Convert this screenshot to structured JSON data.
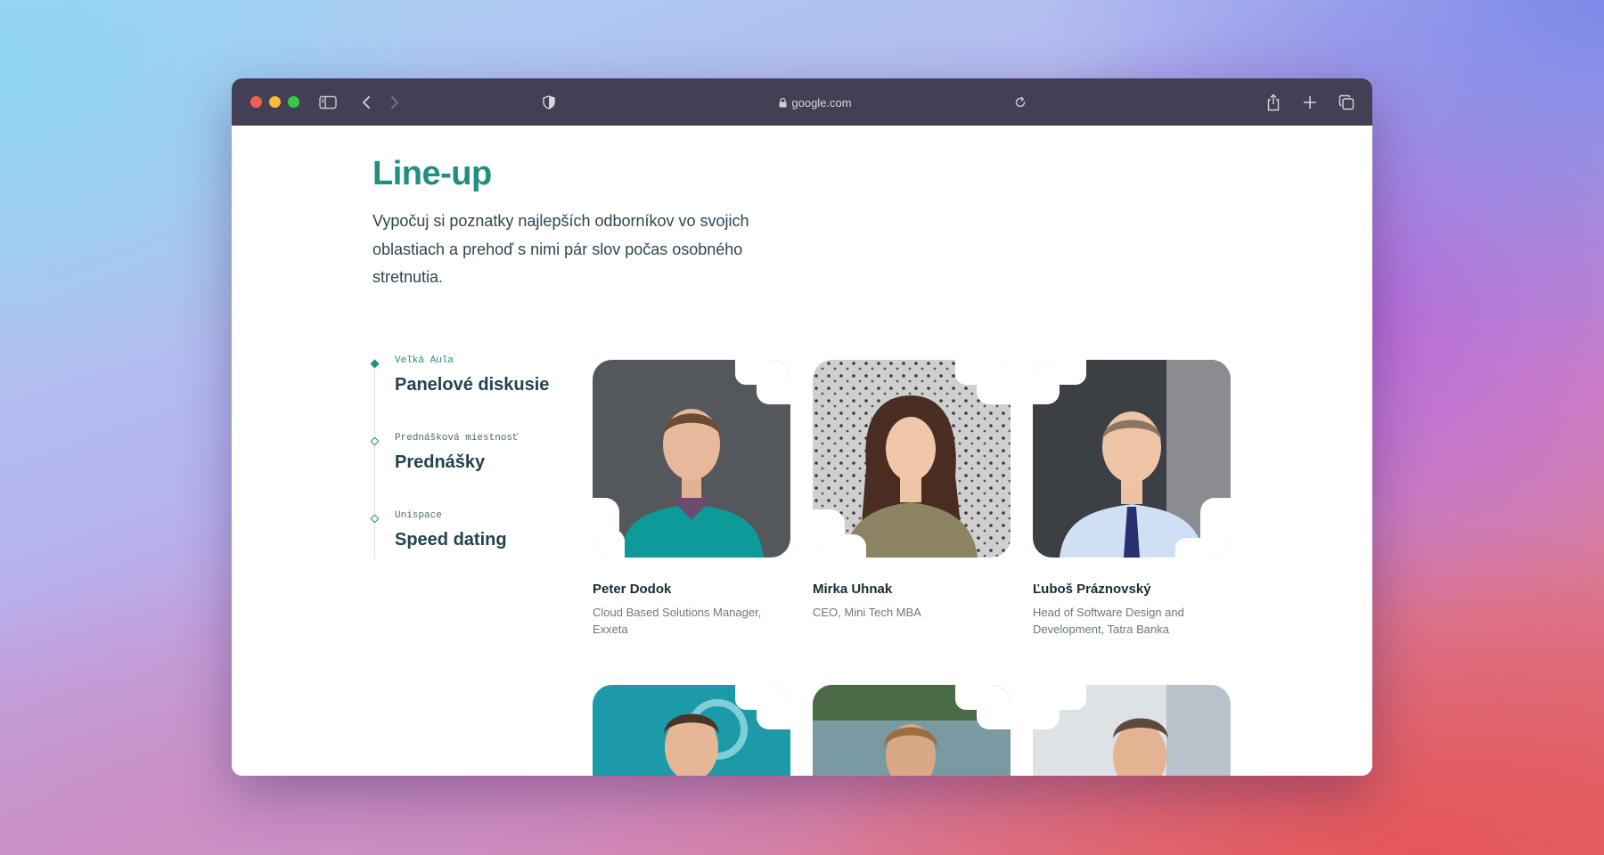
{
  "browser": {
    "url": "google.com"
  },
  "page": {
    "title": "Line-up",
    "intro": "Vypočuj si poznatky najlepších odborníkov vo svojich oblastiach a prehoď s nimi pár slov počas osobného stretnutia."
  },
  "schedule": [
    {
      "room": "Veľká Aula",
      "name": "Panelové diskusie"
    },
    {
      "room": "Prednášková miestnosť",
      "name": "Prednášky"
    },
    {
      "room": "Unispace",
      "name": "Speed dating"
    }
  ],
  "speakers": [
    {
      "name": "Peter Dodok",
      "role": "Cloud Based Solutions Manager, Exxeta"
    },
    {
      "name": "Mirka Uhnak",
      "role": "CEO, Mini Tech MBA"
    },
    {
      "name": "Ľuboš Práznovský",
      "role": "Head of Software Design and Development, Tatra Banka"
    }
  ],
  "colors": {
    "accent": "#1f8f7f",
    "toolbar": "#433f55"
  }
}
